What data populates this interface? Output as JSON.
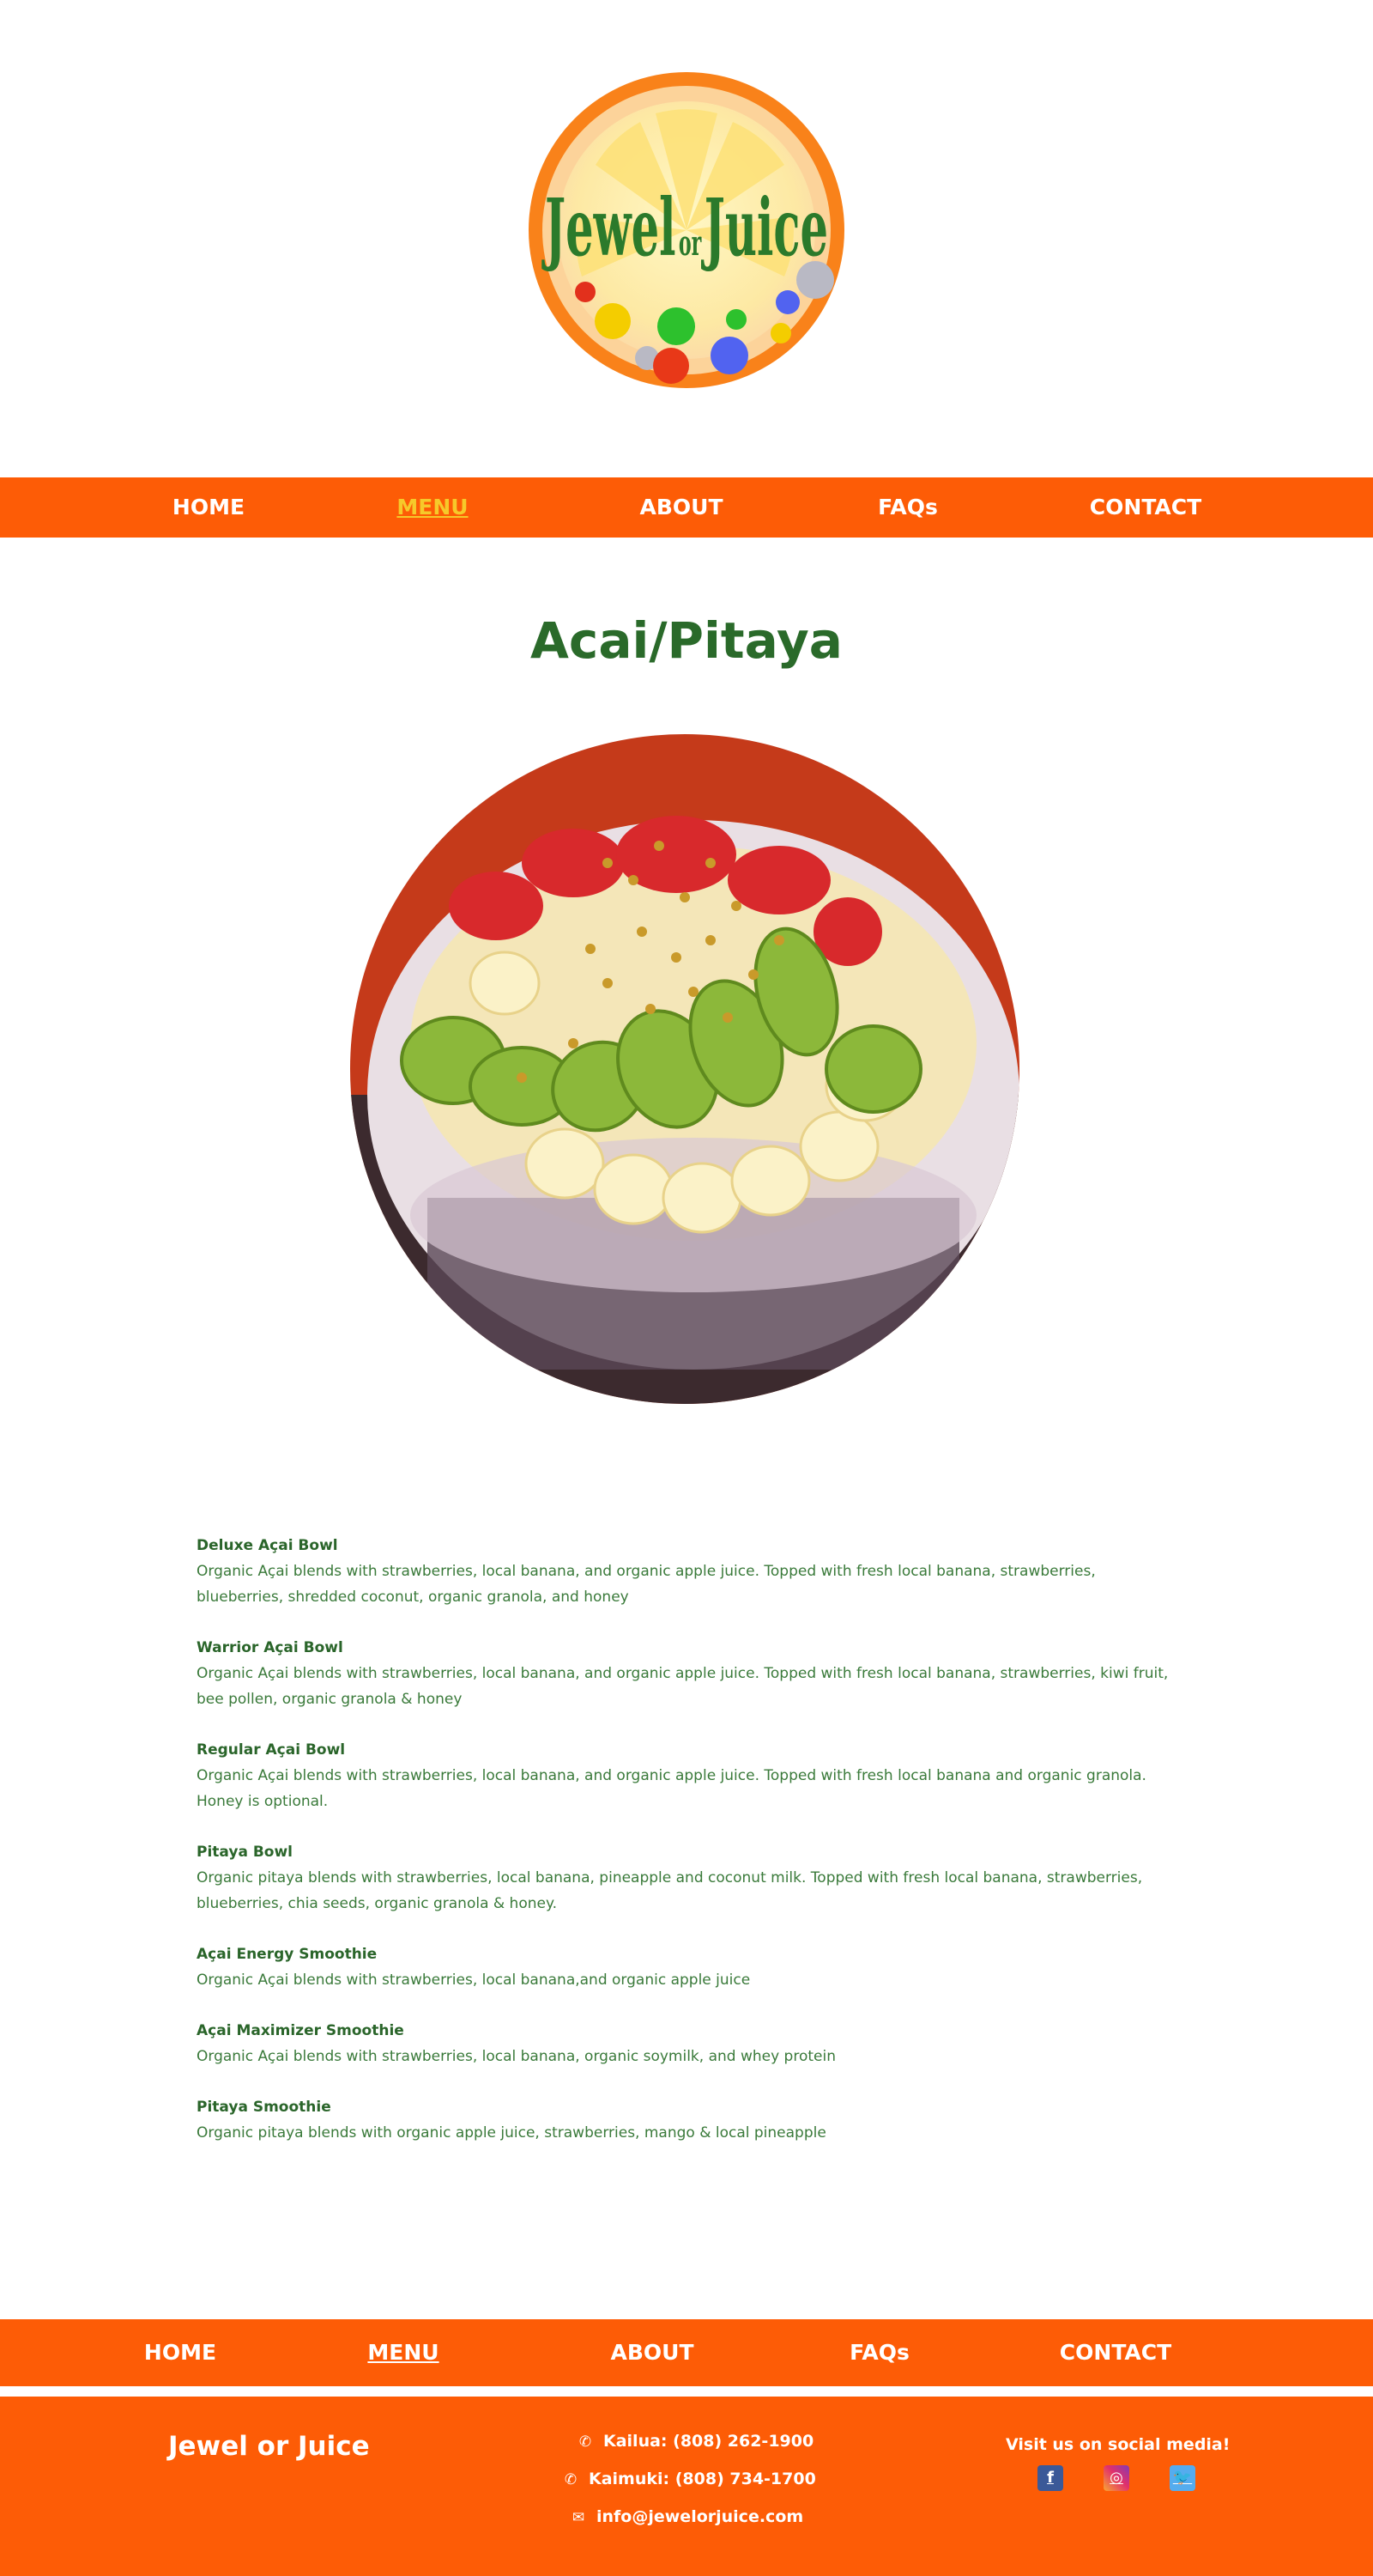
{
  "logo": {
    "word1": "Jewel",
    "word2": "or",
    "word3": "Juice"
  },
  "nav": {
    "items": [
      {
        "label": "HOME",
        "active": false
      },
      {
        "label": "MENU",
        "active": true
      },
      {
        "label": "ABOUT",
        "active": false
      },
      {
        "label": "FAQs",
        "active": false
      },
      {
        "label": "CONTACT",
        "active": false
      }
    ]
  },
  "page": {
    "title": "Acai/Pitaya"
  },
  "menu": [
    {
      "name": "Deluxe Açai Bowl",
      "desc": "Organic Açai blends with strawberries, local banana, and organic apple juice. Topped with fresh local banana, strawberries, blueberries, shredded coconut, organic granola, and honey"
    },
    {
      "name": "Warrior Açai Bowl",
      "desc": "Organic Açai blends with strawberries, local banana, and organic apple juice. Topped with fresh local banana, strawberries, kiwi fruit, bee pollen, organic granola & honey"
    },
    {
      "name": "Regular Açai Bowl",
      "desc": "Organic Açai blends with strawberries, local banana, and organic apple juice. Topped with fresh local banana and organic granola.  Honey is optional."
    },
    {
      "name": "Pitaya Bowl",
      "desc": "Organic pitaya blends with strawberries, local banana, pineapple and coconut milk. Topped with fresh local banana, strawberries, blueberries, chia seeds, organic granola & honey."
    },
    {
      "name": "Açai Energy Smoothie",
      "desc": "Organic Açai blends with strawberries, local banana,and organic apple juice"
    },
    {
      "name": "Açai Maximizer Smoothie",
      "desc": "Organic Açai blends with strawberries, local banana, organic soymilk, and whey protein"
    },
    {
      "name": "Pitaya Smoothie",
      "desc": "Organic pitaya blends with organic apple juice, strawberries, mango & local pineapple"
    }
  ],
  "footer": {
    "brand": "Jewel or Juice",
    "kailua": "Kailua: (808) 262-1900",
    "kaimuki": "Kaimuki: (808) 734-1700",
    "email": "info@jewelorjuice.com",
    "social_title": "Visit us on social media!",
    "social": [
      {
        "icon": "facebook-icon",
        "glyph": "f"
      },
      {
        "icon": "instagram-icon",
        "glyph": "◎"
      },
      {
        "icon": "twitter-icon",
        "glyph": "🐦"
      }
    ]
  },
  "colors": {
    "brand_orange": "#fd5c06",
    "text_green": "#2a6a2a",
    "active_nav": "#f6c92a"
  }
}
